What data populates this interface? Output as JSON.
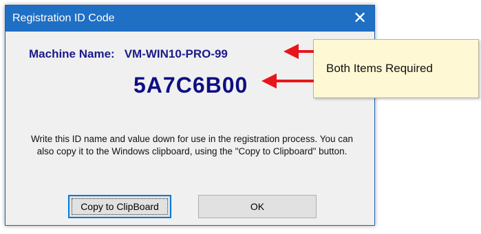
{
  "dialog": {
    "title": "Registration ID Code",
    "close_glyph": "✕",
    "machine_label": "Machine Name:",
    "machine_value": "VM-WIN10-PRO-99",
    "id_code": "5A7C6B00",
    "instructions": "Write this ID name and value down for use in the registration process. You can also copy it to the Windows clipboard, using the \"Copy to Clipboard\" button.",
    "buttons": {
      "copy": "Copy to ClipBoard",
      "ok": "OK"
    }
  },
  "callout": {
    "text": "Both Items Required"
  },
  "colors": {
    "titlebar": "#1f6fc5",
    "label_blue": "#1a1a8a",
    "arrow_red": "#e8151b",
    "callout_bg": "#fff8d4"
  },
  "icons": {
    "close": "close-icon",
    "arrows": "red-arrow-icon"
  }
}
